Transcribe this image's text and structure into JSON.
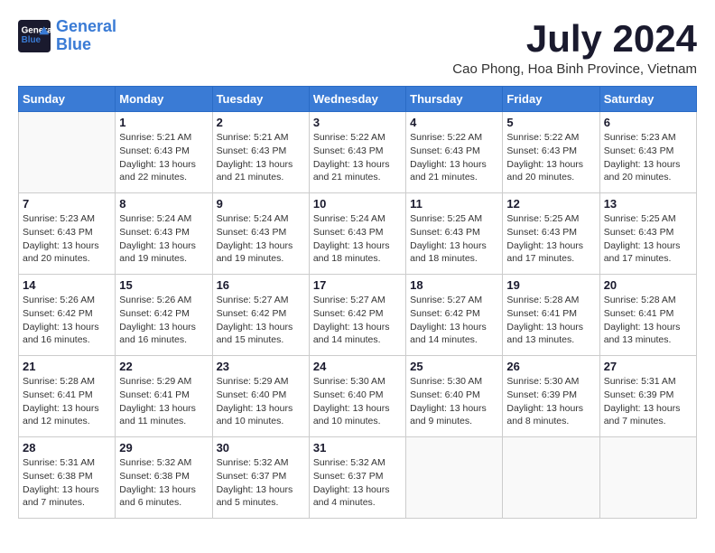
{
  "header": {
    "logo_line1": "General",
    "logo_line2": "Blue",
    "month_year": "July 2024",
    "location": "Cao Phong, Hoa Binh Province, Vietnam"
  },
  "days_of_week": [
    "Sunday",
    "Monday",
    "Tuesday",
    "Wednesday",
    "Thursday",
    "Friday",
    "Saturday"
  ],
  "weeks": [
    [
      {
        "day": "",
        "info": ""
      },
      {
        "day": "1",
        "info": "Sunrise: 5:21 AM\nSunset: 6:43 PM\nDaylight: 13 hours and 22 minutes."
      },
      {
        "day": "2",
        "info": "Sunrise: 5:21 AM\nSunset: 6:43 PM\nDaylight: 13 hours and 21 minutes."
      },
      {
        "day": "3",
        "info": "Sunrise: 5:22 AM\nSunset: 6:43 PM\nDaylight: 13 hours and 21 minutes."
      },
      {
        "day": "4",
        "info": "Sunrise: 5:22 AM\nSunset: 6:43 PM\nDaylight: 13 hours and 21 minutes."
      },
      {
        "day": "5",
        "info": "Sunrise: 5:22 AM\nSunset: 6:43 PM\nDaylight: 13 hours and 20 minutes."
      },
      {
        "day": "6",
        "info": "Sunrise: 5:23 AM\nSunset: 6:43 PM\nDaylight: 13 hours and 20 minutes."
      }
    ],
    [
      {
        "day": "7",
        "info": "Sunrise: 5:23 AM\nSunset: 6:43 PM\nDaylight: 13 hours and 20 minutes."
      },
      {
        "day": "8",
        "info": "Sunrise: 5:24 AM\nSunset: 6:43 PM\nDaylight: 13 hours and 19 minutes."
      },
      {
        "day": "9",
        "info": "Sunrise: 5:24 AM\nSunset: 6:43 PM\nDaylight: 13 hours and 19 minutes."
      },
      {
        "day": "10",
        "info": "Sunrise: 5:24 AM\nSunset: 6:43 PM\nDaylight: 13 hours and 18 minutes."
      },
      {
        "day": "11",
        "info": "Sunrise: 5:25 AM\nSunset: 6:43 PM\nDaylight: 13 hours and 18 minutes."
      },
      {
        "day": "12",
        "info": "Sunrise: 5:25 AM\nSunset: 6:43 PM\nDaylight: 13 hours and 17 minutes."
      },
      {
        "day": "13",
        "info": "Sunrise: 5:25 AM\nSunset: 6:43 PM\nDaylight: 13 hours and 17 minutes."
      }
    ],
    [
      {
        "day": "14",
        "info": "Sunrise: 5:26 AM\nSunset: 6:42 PM\nDaylight: 13 hours and 16 minutes."
      },
      {
        "day": "15",
        "info": "Sunrise: 5:26 AM\nSunset: 6:42 PM\nDaylight: 13 hours and 16 minutes."
      },
      {
        "day": "16",
        "info": "Sunrise: 5:27 AM\nSunset: 6:42 PM\nDaylight: 13 hours and 15 minutes."
      },
      {
        "day": "17",
        "info": "Sunrise: 5:27 AM\nSunset: 6:42 PM\nDaylight: 13 hours and 14 minutes."
      },
      {
        "day": "18",
        "info": "Sunrise: 5:27 AM\nSunset: 6:42 PM\nDaylight: 13 hours and 14 minutes."
      },
      {
        "day": "19",
        "info": "Sunrise: 5:28 AM\nSunset: 6:41 PM\nDaylight: 13 hours and 13 minutes."
      },
      {
        "day": "20",
        "info": "Sunrise: 5:28 AM\nSunset: 6:41 PM\nDaylight: 13 hours and 13 minutes."
      }
    ],
    [
      {
        "day": "21",
        "info": "Sunrise: 5:28 AM\nSunset: 6:41 PM\nDaylight: 13 hours and 12 minutes."
      },
      {
        "day": "22",
        "info": "Sunrise: 5:29 AM\nSunset: 6:41 PM\nDaylight: 13 hours and 11 minutes."
      },
      {
        "day": "23",
        "info": "Sunrise: 5:29 AM\nSunset: 6:40 PM\nDaylight: 13 hours and 10 minutes."
      },
      {
        "day": "24",
        "info": "Sunrise: 5:30 AM\nSunset: 6:40 PM\nDaylight: 13 hours and 10 minutes."
      },
      {
        "day": "25",
        "info": "Sunrise: 5:30 AM\nSunset: 6:40 PM\nDaylight: 13 hours and 9 minutes."
      },
      {
        "day": "26",
        "info": "Sunrise: 5:30 AM\nSunset: 6:39 PM\nDaylight: 13 hours and 8 minutes."
      },
      {
        "day": "27",
        "info": "Sunrise: 5:31 AM\nSunset: 6:39 PM\nDaylight: 13 hours and 7 minutes."
      }
    ],
    [
      {
        "day": "28",
        "info": "Sunrise: 5:31 AM\nSunset: 6:38 PM\nDaylight: 13 hours and 7 minutes."
      },
      {
        "day": "29",
        "info": "Sunrise: 5:32 AM\nSunset: 6:38 PM\nDaylight: 13 hours and 6 minutes."
      },
      {
        "day": "30",
        "info": "Sunrise: 5:32 AM\nSunset: 6:37 PM\nDaylight: 13 hours and 5 minutes."
      },
      {
        "day": "31",
        "info": "Sunrise: 5:32 AM\nSunset: 6:37 PM\nDaylight: 13 hours and 4 minutes."
      },
      {
        "day": "",
        "info": ""
      },
      {
        "day": "",
        "info": ""
      },
      {
        "day": "",
        "info": ""
      }
    ]
  ]
}
